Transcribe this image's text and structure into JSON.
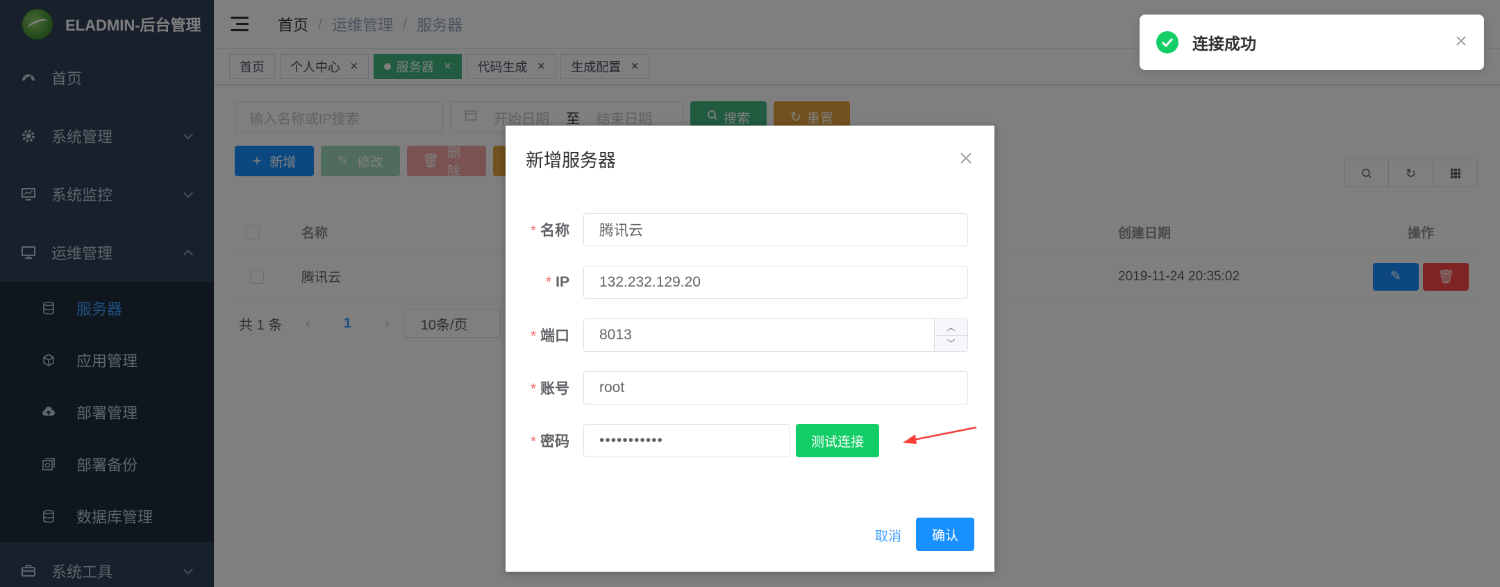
{
  "app": {
    "logo_text": "ELADMIN-后台管理"
  },
  "sidebar": {
    "items": [
      {
        "label": "首页",
        "icon": "dashboard-icon"
      },
      {
        "label": "系统管理",
        "icon": "gear-icon"
      },
      {
        "label": "系统监控",
        "icon": "monitor-icon"
      },
      {
        "label": "运维管理",
        "icon": "ops-icon"
      }
    ],
    "submenu": [
      {
        "label": "服务器",
        "icon": "server-icon"
      },
      {
        "label": "应用管理",
        "icon": "cube-icon"
      },
      {
        "label": "部署管理",
        "icon": "cloud-upload-icon"
      },
      {
        "label": "部署备份",
        "icon": "backup-icon"
      },
      {
        "label": "数据库管理",
        "icon": "database-icon"
      }
    ],
    "bottom_item": {
      "label": "系统工具",
      "icon": "tools-icon"
    }
  },
  "breadcrumb": [
    "首页",
    "运维管理",
    "服务器"
  ],
  "tags": [
    "首页",
    "个人中心",
    "服务器",
    "代码生成",
    "生成配置"
  ],
  "filter": {
    "search_placeholder": "输入名称或IP搜索",
    "date_start": "开始日期",
    "date_sep": "至",
    "date_end": "结束日期",
    "search_label": "搜索",
    "reset_label": "重置"
  },
  "toolbar": {
    "add_label": "新增",
    "edit_label": "修改",
    "delete_label": "删除"
  },
  "table": {
    "headers": {
      "name": "名称",
      "created": "创建日期",
      "ops": "操作"
    },
    "rows": [
      {
        "name": "腾讯云",
        "created": "2019-11-24 20:35:02"
      }
    ]
  },
  "pager": {
    "total": "共 1 条",
    "page": "1",
    "size": "10条/页"
  },
  "dialog": {
    "title": "新增服务器",
    "fields": {
      "name_label": "名称",
      "name_value": "腾讯云",
      "ip_label": "IP",
      "ip_value": "132.232.129.20",
      "port_label": "端口",
      "port_value": "8013",
      "account_label": "账号",
      "account_value": "root",
      "password_label": "密码",
      "password_value": "•••••••••••"
    },
    "test_label": "测试连接",
    "cancel_label": "取消",
    "confirm_label": "确认"
  },
  "toast": {
    "title": "连接成功"
  },
  "colors": {
    "primary": "#1890ff",
    "success": "#13ce66",
    "sidebar_bg": "#304156",
    "tag_active": "#42b983"
  }
}
